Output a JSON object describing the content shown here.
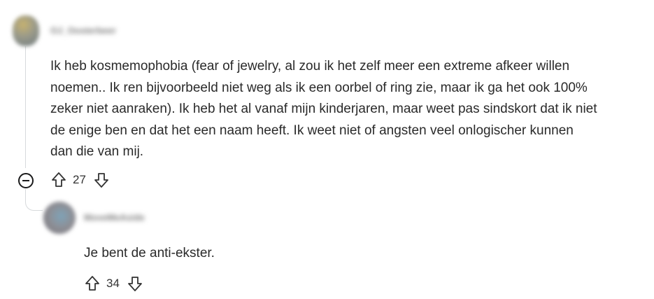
{
  "comments": [
    {
      "username": "OJ_Oosterbeer",
      "body_lines": [
        "Ik heb kosmemophobia (fear of jewelry, al zou ik het zelf meer een extreme afkeer willen",
        "noemen.. Ik ren bijvoorbeeld niet weg als ik een oorbel of ring zie, maar ik ga het ook 100%",
        "zeker niet aanraken). Ik heb het al vanaf mijn kinderjaren, maar weet pas sindskort dat ik niet",
        "de enige ben en dat het een naam heeft. Ik weet niet of angsten veel onlogischer kunnen",
        "dan die van mij."
      ],
      "score": "27"
    },
    {
      "username": "MoveMeAside",
      "body_lines": [
        "Je bent de anti-ekster."
      ],
      "score": "34"
    }
  ],
  "icons": {
    "upvote": "arrow-up-outline",
    "downvote": "arrow-down-outline",
    "collapse": "minus-circle"
  },
  "colors": {
    "thread_line": "#d7dadc",
    "text": "#2a2a2a"
  }
}
